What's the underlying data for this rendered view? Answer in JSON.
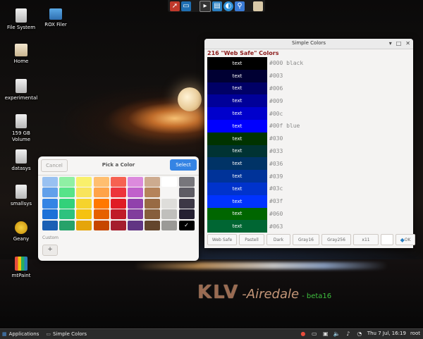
{
  "top_launcher": {
    "icons": [
      "rocket-icon",
      "screen-icon",
      "terminal-icon",
      "files-icon",
      "browser-icon",
      "magnifier-icon",
      "folder-icon"
    ]
  },
  "desktop": {
    "icons": [
      {
        "label": "File System",
        "icon": "drive-icon"
      },
      {
        "label": "ROX Filer",
        "icon": "folder-icon"
      },
      {
        "label": "Home",
        "icon": "home-folder-icon"
      },
      {
        "label": "experimental",
        "icon": "drive-icon"
      },
      {
        "label": "159 GB\nVolume",
        "icon": "drive-icon"
      },
      {
        "label": "datasys",
        "icon": "drive-icon"
      },
      {
        "label": "smallsys",
        "icon": "drive-icon"
      },
      {
        "label": "Geany",
        "icon": "teapot-icon"
      },
      {
        "label": "mtPaint",
        "icon": "pencils-icon"
      }
    ]
  },
  "picker": {
    "title": "Pick a Color",
    "cancel_label": "Cancel",
    "select_label": "Select",
    "custom_label": "Custom",
    "add_label": "+",
    "check_mark": "✓",
    "selected_color": "#000000",
    "palette": [
      [
        "#99c1f1",
        "#8ff0a4",
        "#f9f06b",
        "#ffbe6f",
        "#f66151",
        "#dc8add",
        "#cdab8f",
        "#ffffff",
        "#77767b"
      ],
      [
        "#62a0ea",
        "#57e389",
        "#f8e45c",
        "#ffa348",
        "#ed333b",
        "#c061cb",
        "#b5835a",
        "#f6f5f4",
        "#5e5c64"
      ],
      [
        "#3584e4",
        "#33d17a",
        "#f6d32d",
        "#ff7800",
        "#e01b24",
        "#9141ac",
        "#986a44",
        "#deddda",
        "#3d3846"
      ],
      [
        "#1c71d8",
        "#2ec27e",
        "#f5c211",
        "#e66100",
        "#c01c28",
        "#813d9c",
        "#865e3c",
        "#c0bfbc",
        "#241f31"
      ],
      [
        "#1a5fb4",
        "#26a269",
        "#e5a50a",
        "#c64600",
        "#a51d2d",
        "#613583",
        "#63452c",
        "#9a9996",
        "#000000"
      ]
    ]
  },
  "simple_colors": {
    "window_title": "Simple Colors",
    "heading": "216 \"Web Safe\" Colors",
    "rows": [
      {
        "color": "#000000",
        "text": "text",
        "text_color": "#ffffff",
        "hex": "#000 black"
      },
      {
        "color": "#000033",
        "text": "text",
        "text_color": "#ffffff",
        "hex": "#003"
      },
      {
        "color": "#000066",
        "text": "text",
        "text_color": "#ffffff",
        "hex": "#006"
      },
      {
        "color": "#000099",
        "text": "text",
        "text_color": "#ffffff",
        "hex": "#009"
      },
      {
        "color": "#0000cc",
        "text": "text",
        "text_color": "#ffffff",
        "hex": "#00c"
      },
      {
        "color": "#0000ff",
        "text": "text",
        "text_color": "#ffffff",
        "hex": "#00f blue"
      },
      {
        "color": "#003300",
        "text": "text",
        "text_color": "#ffffff",
        "hex": "#030"
      },
      {
        "color": "#003333",
        "text": "text",
        "text_color": "#ffffff",
        "hex": "#033"
      },
      {
        "color": "#003366",
        "text": "text",
        "text_color": "#ffffff",
        "hex": "#036"
      },
      {
        "color": "#003399",
        "text": "text",
        "text_color": "#ffffff",
        "hex": "#039"
      },
      {
        "color": "#0033cc",
        "text": "text",
        "text_color": "#ffffff",
        "hex": "#03c"
      },
      {
        "color": "#0033ff",
        "text": "text",
        "text_color": "#ffffff",
        "hex": "#03f"
      },
      {
        "color": "#006600",
        "text": "text",
        "text_color": "#ffffff",
        "hex": "#060"
      },
      {
        "color": "#006633",
        "text": "text",
        "text_color": "#ffffff",
        "hex": "#063"
      }
    ],
    "buttons": [
      "Web Safe",
      "Pastell",
      "Dark",
      "Gray16",
      "Gray256",
      "x11"
    ],
    "ok_label": "OK"
  },
  "logo": {
    "klv": "KLV",
    "airedale": "-Airedale",
    "beta": "- beta16"
  },
  "taskbar": {
    "applications_label": "Applications",
    "task_label": "Simple Colors",
    "clock": "Thu  7 Jul, 16:19",
    "user": "root"
  }
}
